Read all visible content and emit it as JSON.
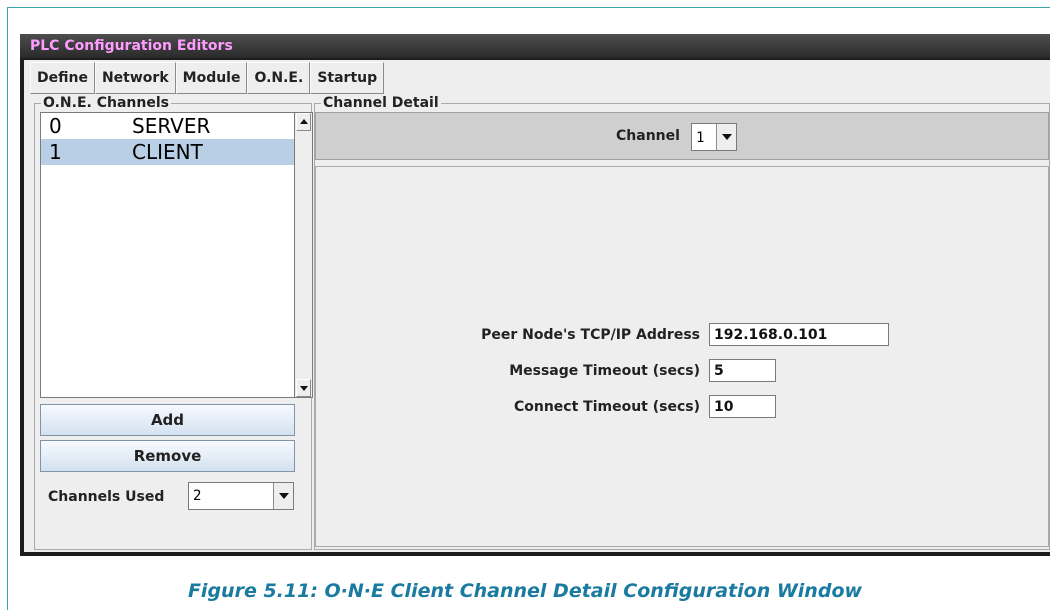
{
  "window": {
    "title": "PLC Configuration Editors"
  },
  "menubar": {
    "items": [
      "Define",
      "Network",
      "Module",
      "O.N.E.",
      "Startup"
    ]
  },
  "left_panel": {
    "legend": "O.N.E. Channels",
    "channels": [
      {
        "num": "0",
        "name": "SERVER",
        "selected": false
      },
      {
        "num": "1",
        "name": "CLIENT",
        "selected": true
      }
    ],
    "add_label": "Add",
    "remove_label": "Remove",
    "channels_used_label": "Channels Used",
    "channels_used_value": "2"
  },
  "right_panel": {
    "legend": "Channel Detail",
    "channel_label": "Channel",
    "channel_value": "1",
    "peer_address_label": "Peer Node's TCP/IP Address",
    "peer_address_value": "192.168.0.101",
    "message_timeout_label": "Message Timeout (secs)",
    "message_timeout_value": "5",
    "connect_timeout_label": "Connect Timeout (secs)",
    "connect_timeout_value": "10"
  },
  "caption": "Figure 5.11: O·N·E Client Channel Detail Configuration Window",
  "colors": {
    "title_text": "#ff9cff",
    "selection": "#b8cfe5",
    "caption": "#1a7aa0",
    "frame_border": "#3aa6a6"
  }
}
